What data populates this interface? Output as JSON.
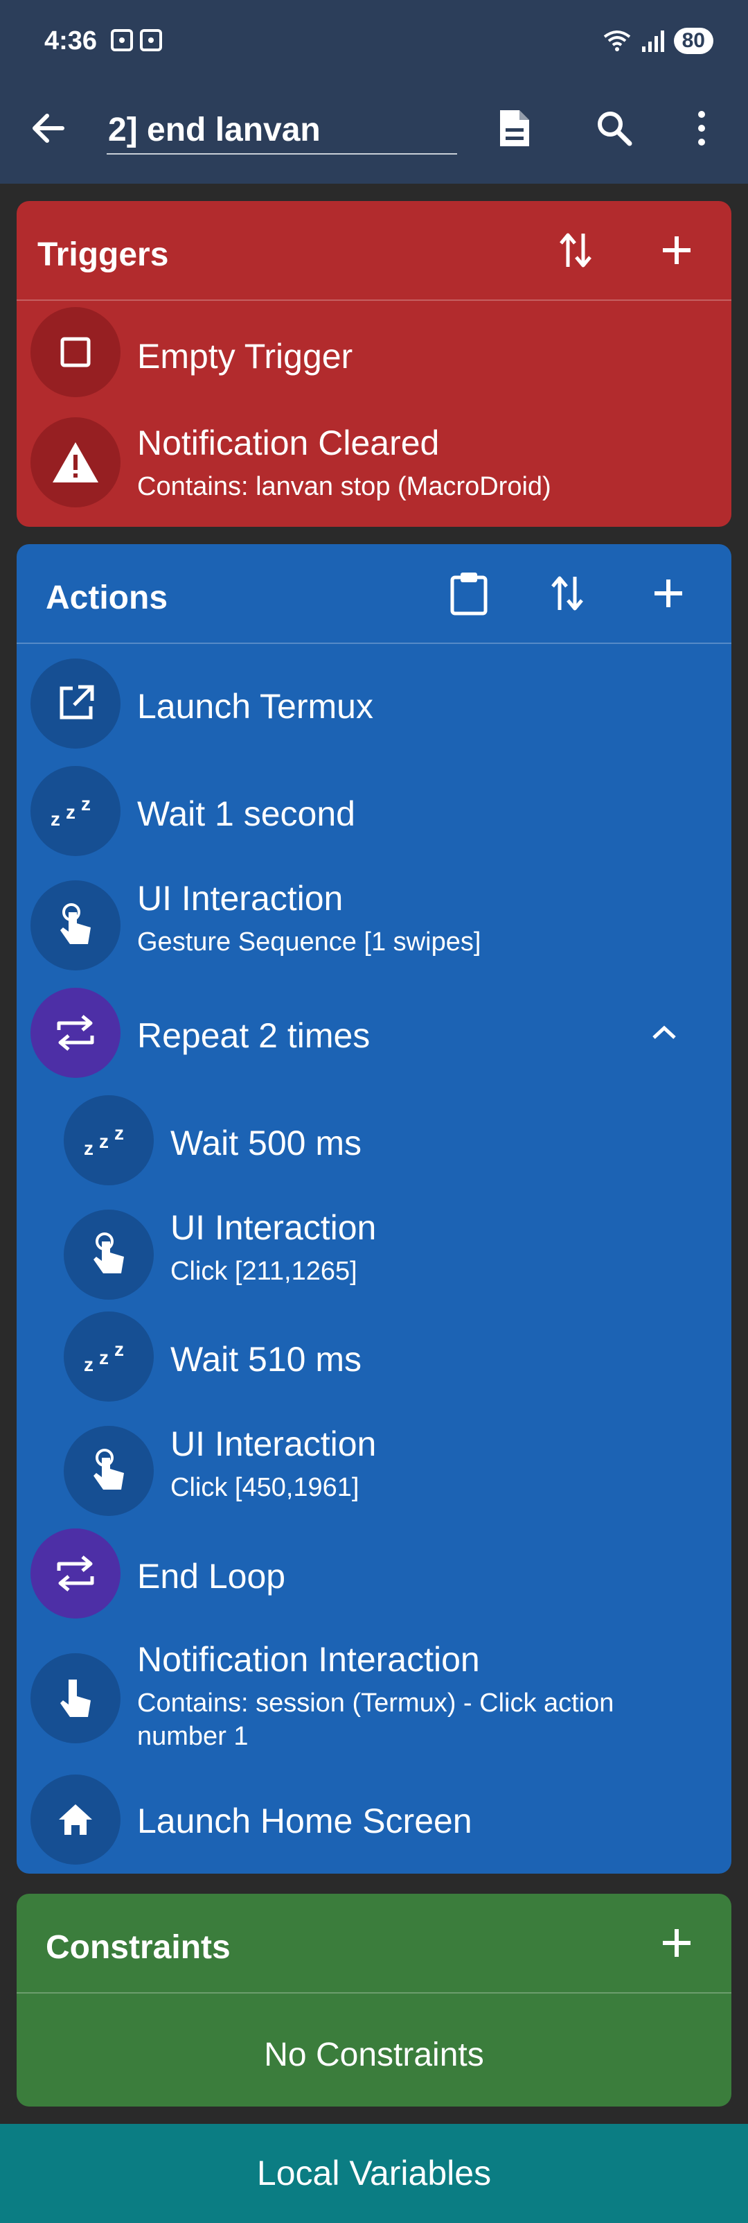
{
  "status_bar": {
    "time": "4:36",
    "battery": "80"
  },
  "app_bar": {
    "macro_name": "2] end lanvan"
  },
  "triggers": {
    "title": "Triggers",
    "items": [
      {
        "title": "Empty Trigger",
        "icon": "square-icon"
      },
      {
        "title": "Notification Cleared",
        "subtitle": "Contains: lanvan stop (MacroDroid)",
        "icon": "warning-icon"
      }
    ]
  },
  "actions": {
    "title": "Actions",
    "items": [
      {
        "title": "Launch Termux",
        "icon": "launch-icon"
      },
      {
        "title": "Wait 1 second",
        "icon": "sleep-icon"
      },
      {
        "title": "UI Interaction",
        "subtitle": "Gesture Sequence [1 swipes]",
        "icon": "touch-icon"
      },
      {
        "title": "Repeat 2 times",
        "icon": "repeat-icon"
      },
      {
        "title": "Wait 500 ms",
        "icon": "sleep-icon"
      },
      {
        "title": "UI Interaction",
        "subtitle": "Click [211,1265]",
        "icon": "touch-icon"
      },
      {
        "title": "Wait 510 ms",
        "icon": "sleep-icon"
      },
      {
        "title": "UI Interaction",
        "subtitle": "Click [450,1961]",
        "icon": "touch-icon"
      },
      {
        "title": "End Loop",
        "icon": "repeat-icon"
      },
      {
        "title": "Notification Interaction",
        "subtitle": "Contains: session (Termux) - Click action number 1",
        "icon": "touch-icon"
      },
      {
        "title": "Launch Home Screen",
        "icon": "home-icon"
      }
    ]
  },
  "constraints": {
    "title": "Constraints",
    "empty_text": "No Constraints"
  },
  "bottom": {
    "local_variables": "Local Variables"
  },
  "colors": {
    "triggers": "#b22b2d",
    "actions": "#1c63b4",
    "loop": "#4d2fa6",
    "constraints": "#3b7d3c",
    "local_variables": "#0b7d83",
    "appbar": "#2c3e5a"
  }
}
